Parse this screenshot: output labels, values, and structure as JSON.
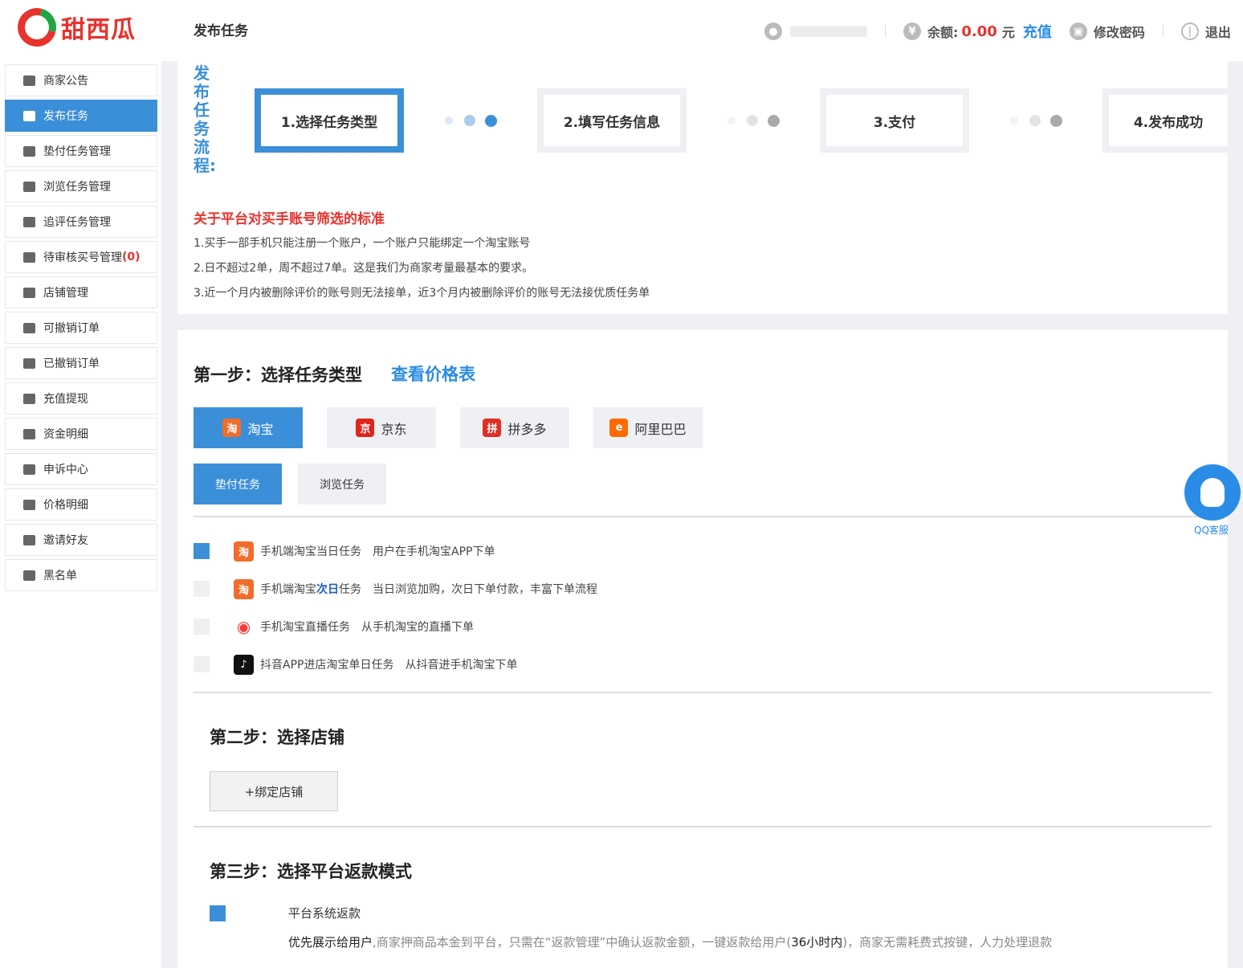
{
  "header": {
    "logo_text": "甜西瓜",
    "page_title": "发布任务",
    "balance_label": "余额:",
    "balance_value": "0.00",
    "balance_unit": "元",
    "recharge": "充值",
    "change_password": "修改密码",
    "logout": "退出"
  },
  "sidebar": {
    "items": [
      {
        "label": "商家公告",
        "icon": "store-icon"
      },
      {
        "label": "发布任务",
        "icon": "document-icon",
        "active": true
      },
      {
        "label": "垫付任务管理",
        "icon": "hand-money-icon"
      },
      {
        "label": "浏览任务管理",
        "icon": "eye-icon"
      },
      {
        "label": "追评任务管理",
        "icon": "comment-icon"
      },
      {
        "label": "待审核买号管理",
        "badge": "(0)",
        "icon": "user-icon"
      },
      {
        "label": "店铺管理",
        "icon": "shop-icon"
      },
      {
        "label": "可撤销订单",
        "icon": "undo-icon"
      },
      {
        "label": "已撤销订单",
        "icon": "cancelled-icon"
      },
      {
        "label": "充值提现",
        "icon": "money-bag-icon"
      },
      {
        "label": "资金明细",
        "icon": "wallet-icon"
      },
      {
        "label": "申诉中心",
        "icon": "appeal-icon"
      },
      {
        "label": "价格明细",
        "icon": "yen-icon"
      },
      {
        "label": "邀请好友",
        "icon": "invite-icon"
      },
      {
        "label": "黑名单",
        "icon": "blacklist-icon"
      }
    ]
  },
  "flow": {
    "label": "发布任务流程:",
    "steps": [
      "1.选择任务类型",
      "2.填写任务信息",
      "3.支付",
      "4.发布成功"
    ],
    "active_step": 1
  },
  "rules": {
    "title": "关于平台对买手账号筛选的标准",
    "items": [
      "1.买手一部手机只能注册一个账户，一个账户只能绑定一个淘宝账号",
      "2.日不超过2单，周不超过7单。这是我们为商家考量最基本的要求。",
      "3.近一个月内被删除评价的账号则无法接单，近3个月内被删除评价的账号无法接优质任务单"
    ]
  },
  "step1": {
    "title": "第一步：选择任务类型",
    "price_link": "查看价格表",
    "platforms": [
      {
        "label": "淘宝",
        "glyph": "淘",
        "color": "#f26c2b",
        "active": true
      },
      {
        "label": "京东",
        "glyph": "京",
        "color": "#e1251b"
      },
      {
        "label": "拼多多",
        "glyph": "拼",
        "color": "#e02e24"
      },
      {
        "label": "阿里巴巴",
        "glyph": "e",
        "color": "#ff6a00"
      }
    ],
    "types": [
      {
        "label": "垫付任务",
        "active": true
      },
      {
        "label": "浏览任务"
      }
    ],
    "tasks": [
      {
        "name": "手机端淘宝当日任务",
        "desc": "用户在手机淘宝APP下单",
        "checked": true,
        "glyph": "淘",
        "color": "#f26c2b"
      },
      {
        "name_pre": "手机端淘宝",
        "name_emph": "次日",
        "name_post": "任务",
        "desc": "当日浏览加购，次日下单付款，丰富下单流程",
        "glyph": "淘",
        "color": "#f26c2b"
      },
      {
        "name": "手机淘宝直播任务",
        "desc": "从手机淘宝的直播下单",
        "glyph": "◉",
        "color": "#ff3a3a"
      },
      {
        "name": "抖音APP进店淘宝单日任务",
        "desc": "从抖音进手机淘宝下单",
        "glyph": "♪",
        "color": "#111111"
      }
    ]
  },
  "step2": {
    "title": "第二步：选择店铺",
    "bind_button": "+绑定店铺"
  },
  "step3": {
    "title": "第三步：选择平台返款模式",
    "option_label": "平台系统返款",
    "desc_dark1": "优先展示给用户",
    "desc_gray1": ",商家押商品本金到平台，只需在“返款管理”中确认返款金额，一键返款给用户(",
    "desc_dark2": "36小时内",
    "desc_gray2": ")，商家无需耗费式按键，人力处理退款"
  },
  "qq": {
    "label": "QQ客服"
  },
  "colors": {
    "accent": "#3b8fd9",
    "brand_red": "#e8322d",
    "link_blue": "#2a8ce6"
  }
}
